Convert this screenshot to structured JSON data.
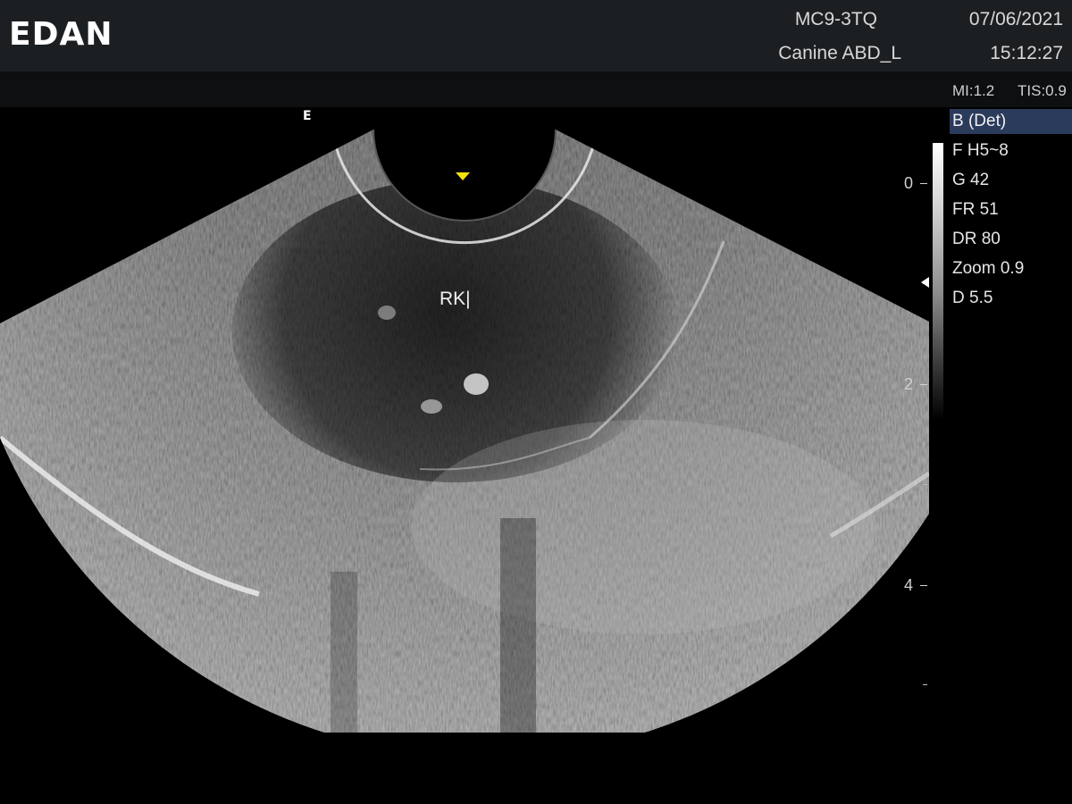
{
  "header": {
    "logo": "EDAN",
    "probe": "MC9-3TQ",
    "preset": "Canine ABD_L",
    "date": "07/06/2021",
    "time": "15:12:27"
  },
  "status": {
    "mi": "MI:1.2",
    "tis": "TIS:0.9"
  },
  "image": {
    "orientation_marker": "E",
    "annotation": "RK|",
    "focus_marker_color": "#f2e20c"
  },
  "depth_scale": {
    "labels": [
      "0",
      "2",
      "4"
    ]
  },
  "params": {
    "mode": "B (Det)",
    "items": [
      "F H5~8",
      "G 42",
      "FR 51",
      "DR 80",
      "Zoom 0.9",
      "D 5.5"
    ]
  },
  "colors": {
    "topbar": "#1c1f22",
    "mode_highlight": "#2b3b5c"
  }
}
